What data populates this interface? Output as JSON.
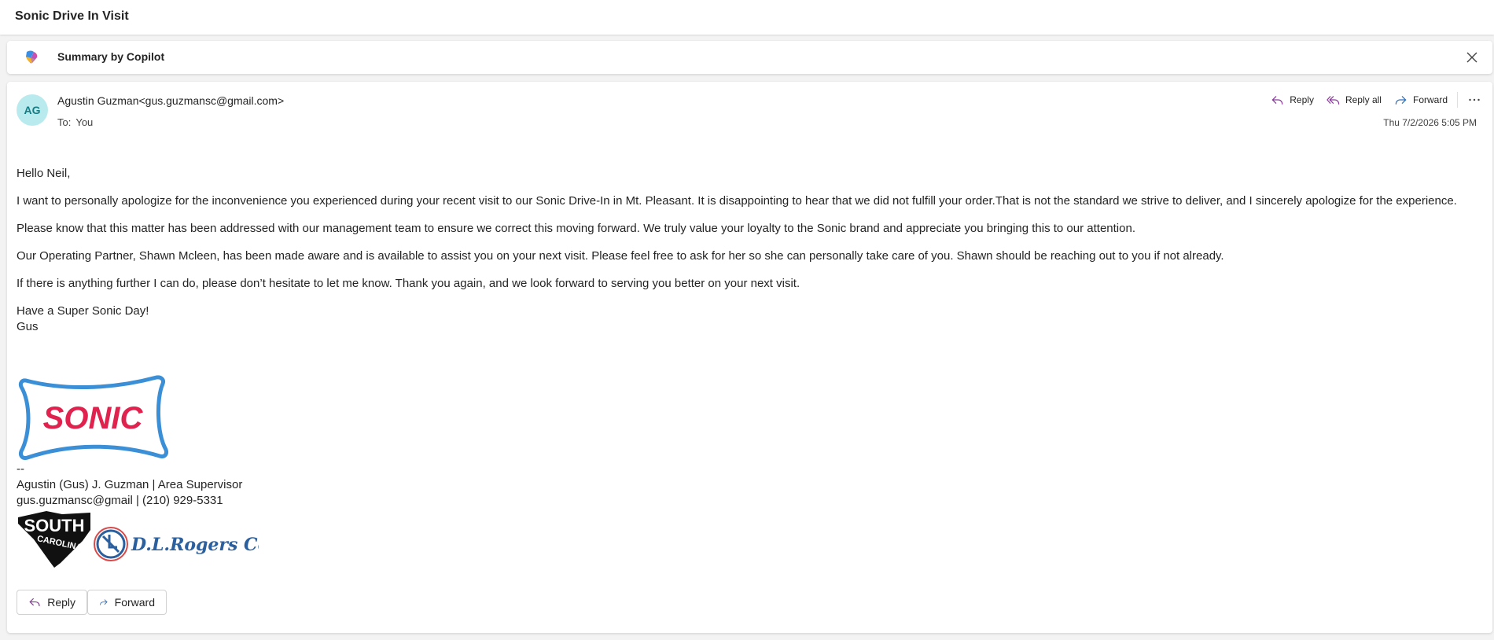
{
  "subject": "Sonic Drive In Visit",
  "copilot": {
    "label": "Summary by Copilot",
    "icon": "copilot-icon",
    "close_icon": "close-icon"
  },
  "message": {
    "avatar_initials": "AG",
    "sender": "Agustin Guzman<gus.guzmansc@gmail.com>",
    "to_label": "To:",
    "to_value": "You",
    "timestamp": "Thu 7/2/2026 5:05 PM",
    "actions": {
      "reply": "Reply",
      "reply_all": "Reply all",
      "forward": "Forward"
    },
    "body": [
      "Hello Neil,",
      "I want to personally apologize for the inconvenience you experienced during your recent visit to our Sonic Drive-In in Mt. Pleasant. It is disappointing to hear that we did not fulfill your order.That is not the standard we strive to deliver, and I sincerely apologize for the experience.",
      "Please know that this matter has been addressed with our management team to ensure we correct this moving forward. We truly value your loyalty to the Sonic brand and appreciate you bringing this to our attention.",
      "Our Operating Partner, Shawn Mcleen, has been made aware and is available to assist you on your next visit. Please feel free to ask for her so she can personally take care of you. Shawn should be reaching out to you if not already.",
      "If there is anything further I can do, please don’t hesitate to let me know.  Thank you again, and we look forward to serving you better on your next visit.",
      "Have a Super Sonic Day!",
      "Gus"
    ],
    "signature": {
      "logo_text": "SONIC",
      "dashes": "--",
      "name_title": "Agustin (Gus) J. Guzman | Area Supervisor",
      "contact": "gus.guzmansc@gmail  |  (210) 929-5331",
      "state_logo_text_1": "SOUTH",
      "state_logo_text_2": "CAROLINA",
      "corp_logo_text": "D.L.Rogers Corp"
    },
    "bottom_actions": {
      "reply": "Reply",
      "forward": "Forward"
    }
  },
  "colors": {
    "avatar_bg": "#b9ebee",
    "avatar_text": "#157c84",
    "reply_icon": "#8a3a9e",
    "forward_icon": "#2f6fbf",
    "sonic_red": "#e0234e",
    "sonic_blue": "#3b8fd6"
  }
}
